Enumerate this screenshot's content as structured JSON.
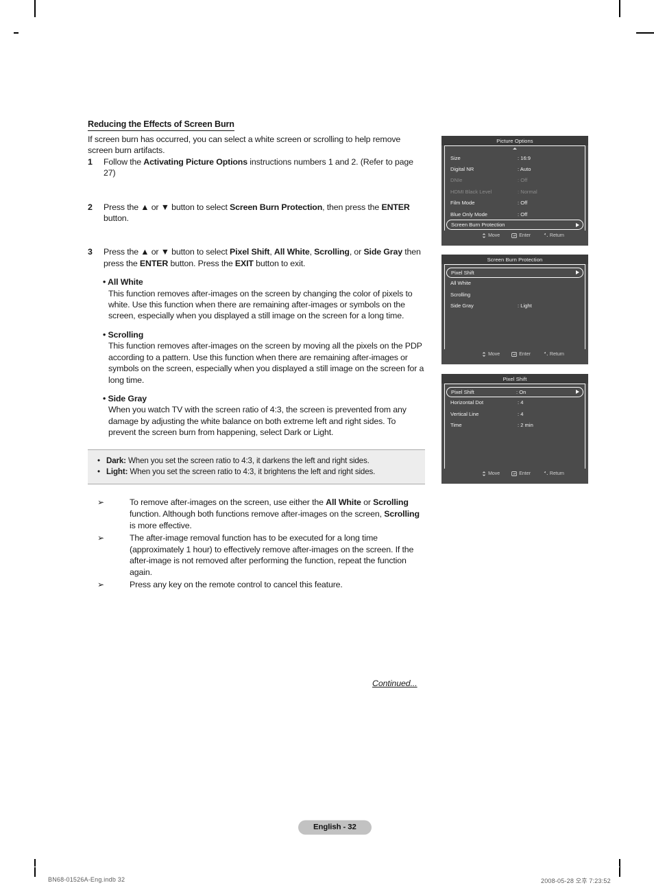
{
  "document": {
    "section_title": "Reducing the Effects of Screen Burn",
    "intro": "If screen burn has occurred, you can select a white screen or scrolling to help remove screen burn artifacts.",
    "continued_label": "Continued...",
    "page_badge": "English - 32",
    "footer_left": "BN68-01526A-Eng.indb   32",
    "footer_right": "2008-05-28   오후 7:23:52"
  },
  "steps": [
    {
      "number": "1",
      "parts": [
        {
          "t": "Follow the ",
          "b": false
        },
        {
          "t": "Activating Picture Options",
          "b": true
        },
        {
          "t": " instructions numbers 1 and 2. (Refer to page 27)",
          "b": false
        }
      ]
    },
    {
      "number": "2",
      "parts": [
        {
          "t": "Press the ▲ or ▼ button to select ",
          "b": false
        },
        {
          "t": "Screen Burn Protection",
          "b": true
        },
        {
          "t": ", then press the ",
          "b": false
        },
        {
          "t": "ENTER",
          "b": true
        },
        {
          "t": " button.",
          "b": false
        }
      ]
    },
    {
      "number": "3",
      "parts": [
        {
          "t": "Press the ▲ or ▼ button to select ",
          "b": false
        },
        {
          "t": "Pixel Shift",
          "b": true
        },
        {
          "t": ", ",
          "b": false
        },
        {
          "t": "All White",
          "b": true
        },
        {
          "t": ", ",
          "b": false
        },
        {
          "t": "Scrolling",
          "b": true
        },
        {
          "t": ", or ",
          "b": false
        },
        {
          "t": "Side Gray",
          "b": true
        },
        {
          "t": " then press the ",
          "b": false
        },
        {
          "t": "ENTER",
          "b": true
        },
        {
          "t": " button. Press the ",
          "b": false
        },
        {
          "t": "EXIT",
          "b": true
        },
        {
          "t": " button to exit.",
          "b": false
        }
      ]
    }
  ],
  "subsections": [
    {
      "heading": "• All White",
      "body": "This function removes after-images on the screen by changing the color of pixels to white. Use this function when there are remaining after-images or symbols on the screen, especially when you displayed a still image on the screen for a long time."
    },
    {
      "heading": "• Scrolling",
      "body": "This function removes after-images on the screen by moving all the pixels on the PDP according to a pattern. Use this function when there are remaining after-images or symbols on the screen, especially when you displayed a still image on the screen for a long time."
    },
    {
      "heading": "• Side Gray",
      "body": "When you watch TV with the screen ratio of 4:3, the screen is prevented from any damage by adjusting the white balance on both extreme left and right sides. To prevent the screen burn from happening, select Dark or Light."
    }
  ],
  "callout": {
    "bullet": "•",
    "rows": [
      {
        "term": "Dark:",
        "text": " When you set the screen ratio to 4:3, it darkens the left and right sides."
      },
      {
        "term": "Light:",
        "text": " When you set the screen ratio to 4:3, it brightens the left and right sides."
      }
    ]
  },
  "notes": {
    "mark": "➢",
    "items": [
      [
        {
          "t": "To remove after-images on the screen, use either the ",
          "b": false
        },
        {
          "t": "All White",
          "b": true
        },
        {
          "t": " or ",
          "b": false
        },
        {
          "t": "Scrolling",
          "b": true
        },
        {
          "t": " function. Although both functions remove after-images on the screen, ",
          "b": false
        },
        {
          "t": "Scrolling",
          "b": true
        },
        {
          "t": " is more effective.",
          "b": false
        }
      ],
      [
        {
          "t": "The after-image removal function has to be executed for a long time (approximately 1 hour) to effectively remove after-images on the screen. If the after-image is not removed after performing the function, repeat the function again.",
          "b": false
        }
      ],
      [
        {
          "t": "Press any key on the remote control to cancel this feature.",
          "b": false
        }
      ]
    ]
  },
  "osd_footer": {
    "move": "Move",
    "enter": "Enter",
    "return": "Return",
    "move_icon": "up-down-arrow-icon",
    "enter_icon": "enter-key-icon",
    "return_icon": "return-arrow-icon"
  },
  "osd_menus": [
    {
      "title": "Picture Options",
      "scroll_up": true,
      "rows": [
        {
          "label": "Size",
          "value": ": 16:9",
          "state": "normal",
          "arrow": false
        },
        {
          "label": "Digital NR",
          "value": ": Auto",
          "state": "normal",
          "arrow": false
        },
        {
          "label": "DNIe",
          "value": ": Off",
          "state": "dim",
          "arrow": false
        },
        {
          "label": "HDMI Black Level",
          "value": ": Normal",
          "state": "dim",
          "arrow": false
        },
        {
          "label": "Film Mode",
          "value": ": Off",
          "state": "normal",
          "arrow": false
        },
        {
          "label": "Blue Only Mode",
          "value": ": Off",
          "state": "normal",
          "arrow": false
        },
        {
          "label": "Screen Burn Protection",
          "value": "",
          "state": "highlighted",
          "arrow": true
        }
      ]
    },
    {
      "title": "Screen Burn Protection",
      "scroll_up": false,
      "rows": [
        {
          "label": "Pixel Shift",
          "value": "",
          "state": "highlighted",
          "arrow": true
        },
        {
          "label": "All White",
          "value": "",
          "state": "normal",
          "arrow": false
        },
        {
          "label": "Scrolling",
          "value": "",
          "state": "normal",
          "arrow": false
        },
        {
          "label": "Side Gray",
          "value": ": Light",
          "state": "normal",
          "arrow": false
        }
      ]
    },
    {
      "title": "Pixel Shift",
      "scroll_up": false,
      "rows": [
        {
          "label": "Pixel Shift",
          "value": ": On",
          "state": "highlighted",
          "arrow": true
        },
        {
          "label": "Horizontal Dot",
          "value": ": 4",
          "state": "normal",
          "arrow": false
        },
        {
          "label": "Vertical Line",
          "value": ": 4",
          "state": "normal",
          "arrow": false
        },
        {
          "label": "Time",
          "value": ": 2 min",
          "state": "normal",
          "arrow": false
        }
      ]
    }
  ],
  "colors": {
    "osd_body": "#4b4b4b",
    "osd_title_bar": "#3b3b3b",
    "osd_text": "#f2f2f2",
    "osd_dim_text": "#8b8b8b",
    "callout_bg": "#ededed",
    "page_badge_bg": "#c2c2c2"
  }
}
